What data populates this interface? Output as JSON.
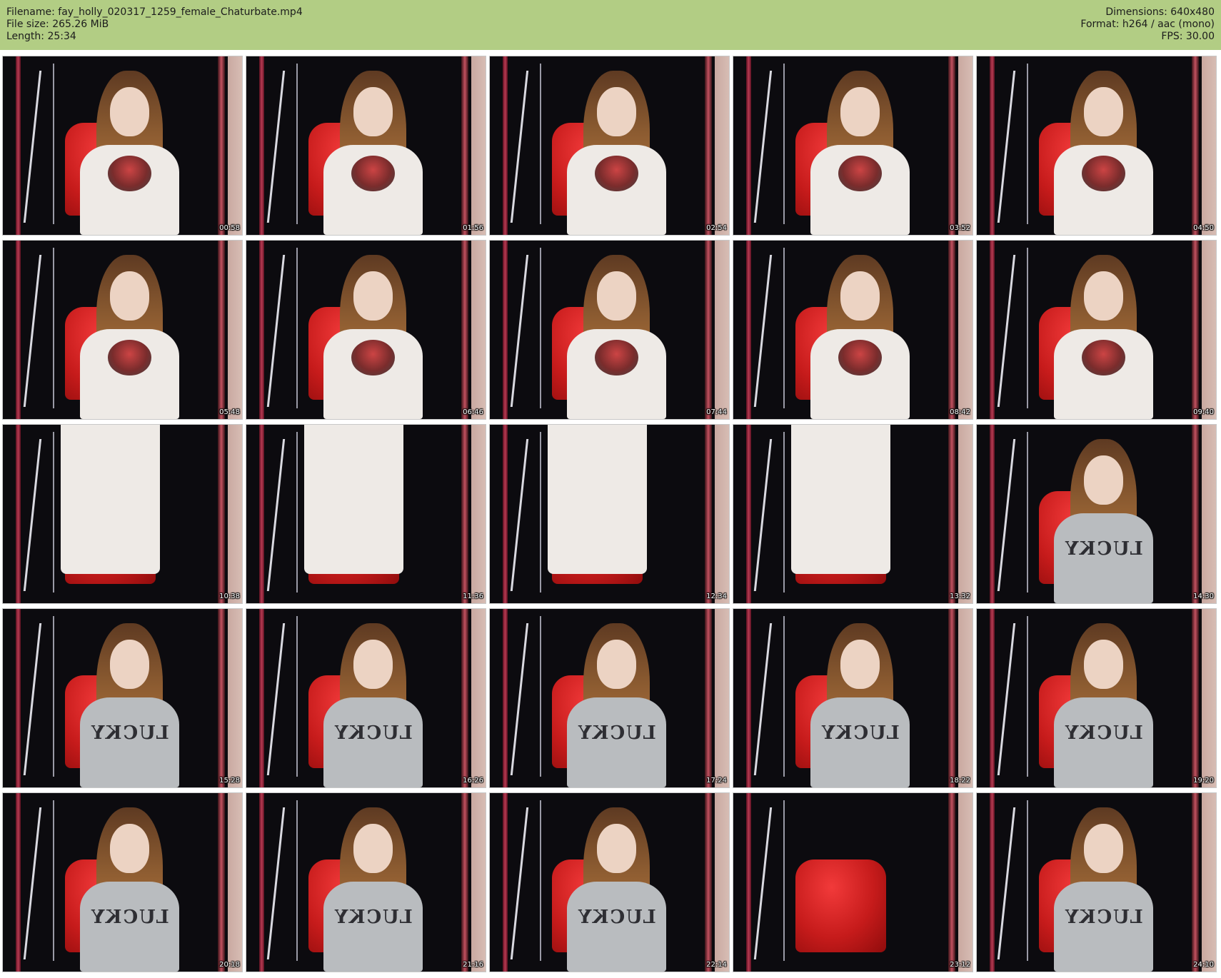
{
  "header": {
    "filename_line": "Filename: fay_holly_020317_1259_female_Chaturbate.mp4",
    "filesize_line": "File size: 265.26 MiB",
    "length_line": "Length: 25:34",
    "dimensions_line": "Dimensions: 640x480",
    "format_line": "Format: h264 / aac (mono)",
    "fps_line": "FPS: 30.00",
    "background_color": "#b2cd84"
  },
  "thumbnails": [
    {
      "time": "00:58",
      "style": "light"
    },
    {
      "time": "01:56",
      "style": "light"
    },
    {
      "time": "02:54",
      "style": "light"
    },
    {
      "time": "03:52",
      "style": "light"
    },
    {
      "time": "04:50",
      "style": "light"
    },
    {
      "time": "05:48",
      "style": "light"
    },
    {
      "time": "06:46",
      "style": "light"
    },
    {
      "time": "07:44",
      "style": "light"
    },
    {
      "time": "08:42",
      "style": "light"
    },
    {
      "time": "09:40",
      "style": "light"
    },
    {
      "time": "10:38",
      "style": "away"
    },
    {
      "time": "11:36",
      "style": "away"
    },
    {
      "time": "12:34",
      "style": "away"
    },
    {
      "time": "13:32",
      "style": "away"
    },
    {
      "time": "14:30",
      "style": "grey"
    },
    {
      "time": "15:28",
      "style": "grey"
    },
    {
      "time": "16:26",
      "style": "grey"
    },
    {
      "time": "17:24",
      "style": "grey"
    },
    {
      "time": "18:22",
      "style": "grey"
    },
    {
      "time": "19:20",
      "style": "grey"
    },
    {
      "time": "20:18",
      "style": "grey"
    },
    {
      "time": "21:16",
      "style": "grey"
    },
    {
      "time": "22:14",
      "style": "grey"
    },
    {
      "time": "23:12",
      "style": "empty"
    },
    {
      "time": "24:10",
      "style": "grey"
    }
  ]
}
